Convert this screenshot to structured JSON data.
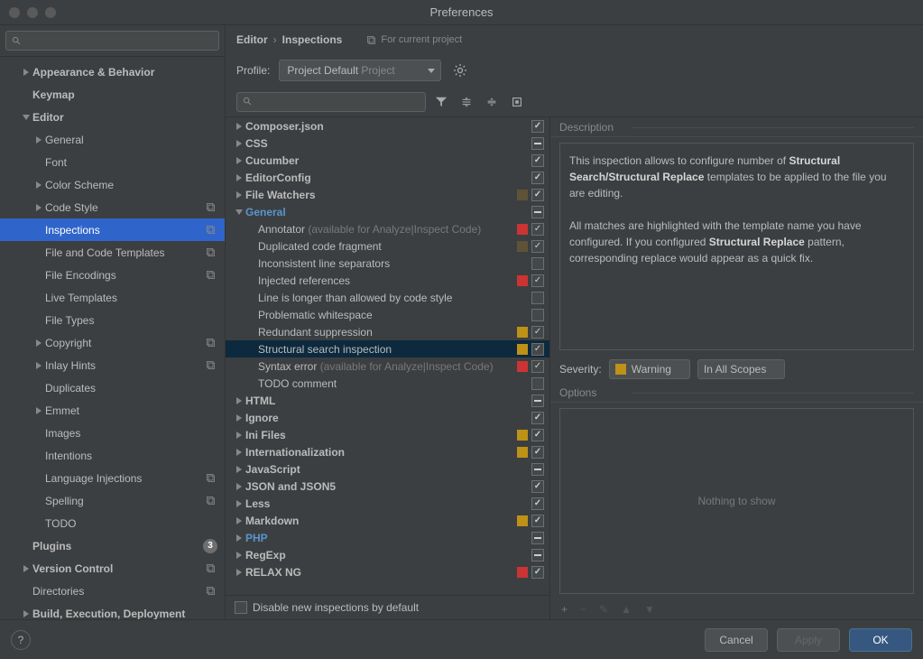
{
  "window": {
    "title": "Preferences"
  },
  "sidebar": {
    "search_placeholder": "",
    "items": [
      {
        "label": "Appearance & Behavior",
        "bold": true,
        "arrow": "right",
        "indent": 1
      },
      {
        "label": "Keymap",
        "bold": true,
        "indent": 1
      },
      {
        "label": "Editor",
        "bold": true,
        "arrow": "down",
        "indent": 1
      },
      {
        "label": "General",
        "arrow": "right",
        "indent": 2
      },
      {
        "label": "Font",
        "indent": 2
      },
      {
        "label": "Color Scheme",
        "arrow": "right",
        "indent": 2
      },
      {
        "label": "Code Style",
        "arrow": "right",
        "indent": 2,
        "badge": "layers"
      },
      {
        "label": "Inspections",
        "indent": 2,
        "selected": true,
        "badge": "layers"
      },
      {
        "label": "File and Code Templates",
        "indent": 2,
        "badge": "layers"
      },
      {
        "label": "File Encodings",
        "indent": 2,
        "badge": "layers"
      },
      {
        "label": "Live Templates",
        "indent": 2
      },
      {
        "label": "File Types",
        "indent": 2
      },
      {
        "label": "Copyright",
        "arrow": "right",
        "indent": 2,
        "badge": "layers"
      },
      {
        "label": "Inlay Hints",
        "arrow": "right",
        "indent": 2,
        "badge": "layers"
      },
      {
        "label": "Duplicates",
        "indent": 2
      },
      {
        "label": "Emmet",
        "arrow": "right",
        "indent": 2
      },
      {
        "label": "Images",
        "indent": 2
      },
      {
        "label": "Intentions",
        "indent": 2
      },
      {
        "label": "Language Injections",
        "indent": 2,
        "badge": "layers"
      },
      {
        "label": "Spelling",
        "indent": 2,
        "badge": "layers"
      },
      {
        "label": "TODO",
        "indent": 2
      },
      {
        "label": "Plugins",
        "bold": true,
        "indent": 1,
        "count": "3"
      },
      {
        "label": "Version Control",
        "bold": true,
        "arrow": "right",
        "indent": 1,
        "badge": "layers"
      },
      {
        "label": "Directories",
        "indent": 1,
        "badge": "layers"
      },
      {
        "label": "Build, Execution, Deployment",
        "bold": true,
        "arrow": "right",
        "indent": 1
      }
    ]
  },
  "breadcrumb": {
    "root": "Editor",
    "current": "Inspections",
    "project_marker": "For current project"
  },
  "profile": {
    "label": "Profile:",
    "value": "Project Default",
    "scope": "Project"
  },
  "inspections": [
    {
      "label": "Composer.json",
      "bold": true,
      "arrow": "right",
      "chk": "checked"
    },
    {
      "label": "CSS",
      "bold": true,
      "arrow": "right",
      "chk": "mixed"
    },
    {
      "label": "Cucumber",
      "bold": true,
      "arrow": "right",
      "chk": "checked"
    },
    {
      "label": "EditorConfig",
      "bold": true,
      "arrow": "right",
      "chk": "checked"
    },
    {
      "label": "File Watchers",
      "bold": true,
      "arrow": "right",
      "sev": "weak",
      "chk": "checked"
    },
    {
      "label": "General",
      "bold": true,
      "arrow": "down",
      "chk": "mixed",
      "link": true
    },
    {
      "label": "Annotator",
      "hint": " (available for Analyze|Inspect Code)",
      "depth": 1,
      "sev": "error",
      "chk": "checked"
    },
    {
      "label": "Duplicated code fragment",
      "depth": 1,
      "sev": "weak",
      "chk": "checked"
    },
    {
      "label": "Inconsistent line separators",
      "depth": 1,
      "chk": "none"
    },
    {
      "label": "Injected references",
      "depth": 1,
      "sev": "error",
      "chk": "checked"
    },
    {
      "label": "Line is longer than allowed by code style",
      "depth": 1,
      "chk": "none"
    },
    {
      "label": "Problematic whitespace",
      "depth": 1,
      "chk": "none"
    },
    {
      "label": "Redundant suppression",
      "depth": 1,
      "sev": "warning",
      "chk": "checked"
    },
    {
      "label": "Structural search inspection",
      "depth": 1,
      "sev": "warning",
      "chk": "checked",
      "selected": true
    },
    {
      "label": "Syntax error",
      "hint": " (available for Analyze|Inspect Code)",
      "depth": 1,
      "sev": "error",
      "chk": "checked"
    },
    {
      "label": "TODO comment",
      "depth": 1,
      "chk": "none"
    },
    {
      "label": "HTML",
      "bold": true,
      "arrow": "right",
      "chk": "mixed"
    },
    {
      "label": "Ignore",
      "bold": true,
      "arrow": "right",
      "chk": "checked"
    },
    {
      "label": "Ini Files",
      "bold": true,
      "arrow": "right",
      "sev": "warning",
      "chk": "checked"
    },
    {
      "label": "Internationalization",
      "bold": true,
      "arrow": "right",
      "sev": "warning",
      "chk": "checked"
    },
    {
      "label": "JavaScript",
      "bold": true,
      "arrow": "right",
      "chk": "mixed"
    },
    {
      "label": "JSON and JSON5",
      "bold": true,
      "arrow": "right",
      "chk": "checked"
    },
    {
      "label": "Less",
      "bold": true,
      "arrow": "right",
      "chk": "checked"
    },
    {
      "label": "Markdown",
      "bold": true,
      "arrow": "right",
      "sev": "warning",
      "chk": "checked"
    },
    {
      "label": "PHP",
      "bold": true,
      "arrow": "right",
      "chk": "mixed",
      "link": true
    },
    {
      "label": "RegExp",
      "bold": true,
      "arrow": "right",
      "chk": "mixed"
    },
    {
      "label": "RELAX NG",
      "bold": true,
      "arrow": "right",
      "sev": "error",
      "chk": "checked"
    }
  ],
  "insp_footer": {
    "disable_label": "Disable new inspections by default"
  },
  "detail": {
    "desc_label": "Description",
    "desc_html": "This inspection allows to configure number of <b>Structural Search/Structural Replace</b> templates to be applied to the file you are editing.<br><br>All matches are highlighted with the template name you have configured. If you configured <b>Structural Replace</b> pattern, corresponding replace would appear as a quick fix.",
    "severity_label": "Severity:",
    "severity_value": "Warning",
    "scope_value": "In All Scopes",
    "options_label": "Options",
    "options_empty": "Nothing to show"
  },
  "footer": {
    "cancel": "Cancel",
    "apply": "Apply",
    "ok": "OK"
  }
}
